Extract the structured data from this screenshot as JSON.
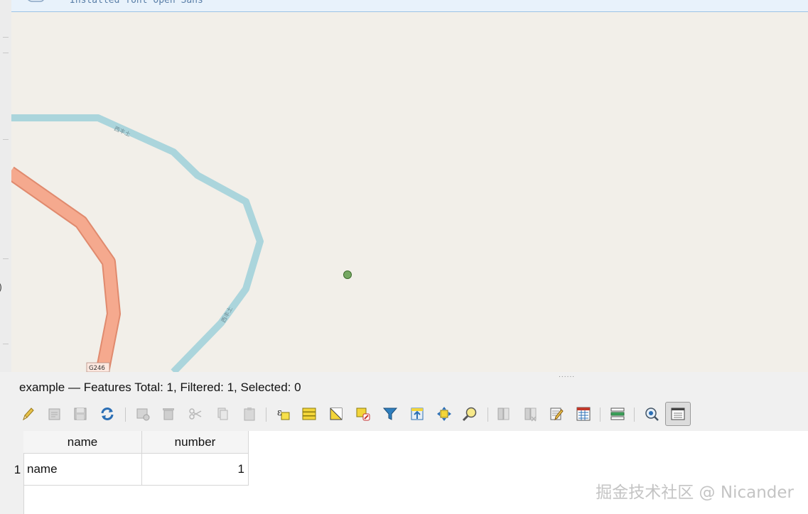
{
  "message_bar": {
    "text": "Installed font Open Sans"
  },
  "map": {
    "road_label_1": "西丰土",
    "road_label_2": "西丰土",
    "shield_label": "G246",
    "colors": {
      "background": "#f2efe9",
      "minor_road": "#abd5dc",
      "major_road": "#f5a98e",
      "major_road_casing": "#e08a6e",
      "point_fill": "#76a862",
      "point_stroke": "#3d6b2c"
    }
  },
  "attribute_table": {
    "title": "example — Features Total: 1, Filtered: 1, Selected: 0",
    "toolbar": [
      {
        "name": "toggle-editing-icon"
      },
      {
        "name": "toggle-multi-edit-icon"
      },
      {
        "name": "save-edits-icon"
      },
      {
        "name": "reload-table-icon"
      },
      {
        "name": "add-feature-icon"
      },
      {
        "name": "delete-selected-icon"
      },
      {
        "name": "cut-icon"
      },
      {
        "name": "copy-icon"
      },
      {
        "name": "paste-icon"
      },
      {
        "name": "select-by-expression-icon"
      },
      {
        "name": "select-all-icon"
      },
      {
        "name": "invert-selection-icon"
      },
      {
        "name": "deselect-all-icon"
      },
      {
        "name": "filter-select-icon"
      },
      {
        "name": "move-selection-top-icon"
      },
      {
        "name": "pan-to-selected-icon"
      },
      {
        "name": "zoom-to-selected-icon"
      },
      {
        "name": "new-field-icon"
      },
      {
        "name": "delete-field-icon"
      },
      {
        "name": "organize-columns-icon"
      },
      {
        "name": "field-calculator-icon"
      },
      {
        "name": "conditional-formatting-icon"
      },
      {
        "name": "actions-icon"
      },
      {
        "name": "dock-table-icon"
      }
    ],
    "columns": [
      "name",
      "number"
    ],
    "rows": [
      {
        "index": "1",
        "name": "name",
        "number": "1"
      }
    ]
  },
  "watermark": "掘金技术社区 @ Nicander"
}
